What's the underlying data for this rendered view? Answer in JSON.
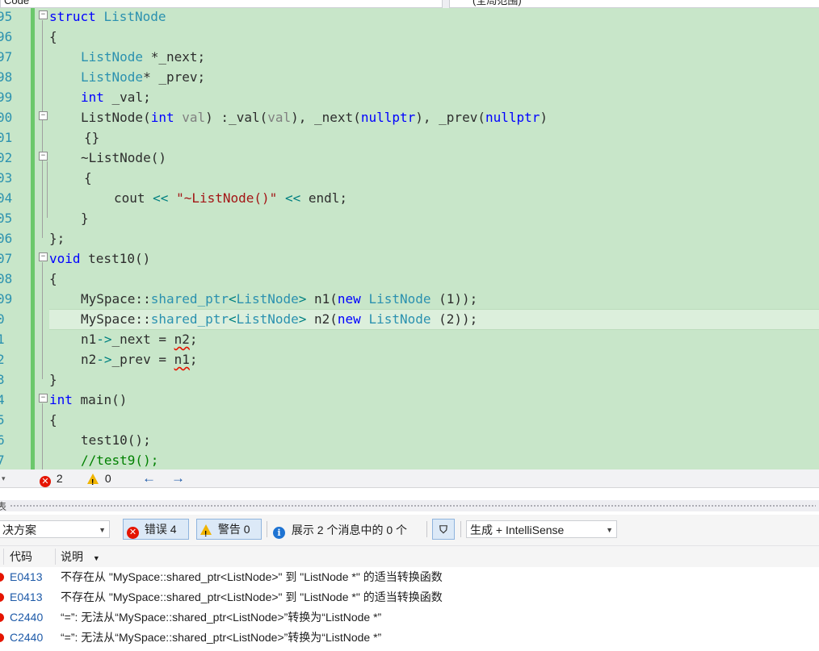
{
  "topbar": {
    "left_selector": "Code",
    "right_selector": "(全局范围)"
  },
  "editor": {
    "line_numbers": [
      "95",
      "96",
      "97",
      "98",
      "99",
      "00",
      "01",
      "02",
      "03",
      "04",
      "05",
      "06",
      "07",
      "08",
      "09",
      "0",
      "1",
      "2",
      "3",
      "4",
      "5",
      "6",
      "7"
    ],
    "lines": [
      {
        "n": "struct",
        "t": "ListNode"
      },
      {
        "t": "{"
      },
      {
        "t": "ListNode",
        "r": " *_next;"
      },
      {
        "t": "ListNode",
        "r": "* _prev;"
      },
      {
        "k": "int",
        "r": " _val;"
      },
      {
        "a": "ListNode(",
        "k": "int",
        "p": "val",
        "r": ") :_val(",
        "p2": "val",
        "r2": "), _next(",
        "k2": "nullptr",
        "r3": "), _prev(",
        "k3": "nullptr",
        "r4": ")"
      },
      {
        "t": "{}"
      },
      {
        "t": "~ListNode()"
      },
      {
        "t": "{"
      },
      {
        "a": "cout ",
        "o": "<<",
        "s": "\"~ListNode()\"",
        "o2": "<<",
        "r": " endl;"
      },
      {
        "t": "}"
      },
      {
        "t": "};"
      },
      {
        "k": "void",
        "r": " test10()"
      },
      {
        "t": "{"
      },
      {
        "a": "MySpace::",
        "y": "shared_ptr",
        "o": "<",
        "y2": "ListNode",
        "o2": ">",
        "r": " n1(",
        "k": "new",
        "y3": "ListNode",
        "r2": " (1));"
      },
      {
        "a": "MySpace::",
        "y": "shared_ptr",
        "o": "<",
        "y2": "ListNode",
        "o2": ">",
        "r": " n2(",
        "k": "new",
        "y3": "ListNode",
        "r2": " (2));"
      },
      {
        "a": "n1",
        "o": "->",
        "r": "_next = ",
        "e": "n2",
        "r2": ";"
      },
      {
        "a": "n2",
        "o": "->",
        "r": "_prev = ",
        "e": "n1",
        "r2": ";"
      },
      {
        "t": "}"
      },
      {
        "k": "int",
        "r": " main()"
      },
      {
        "t": "{"
      },
      {
        "t": "test10();"
      },
      {
        "c": "//test9();"
      }
    ]
  },
  "status_strip": {
    "error_count": "2",
    "warning_count": "0",
    "back_icon": "arrow-left-icon",
    "forward_icon": "arrow-right-icon"
  },
  "panel": {
    "title_fragment": "表",
    "scope_combo": "决方案",
    "errors_button": "错误 4",
    "warnings_button": "警告 0",
    "messages_text": "展示 2 个消息中的 0 个",
    "build_combo": "生成 + IntelliSense",
    "columns": {
      "code": "代码",
      "description": "说明"
    },
    "rows": [
      {
        "code": "E0413",
        "description": "不存在从 \"MySpace::shared_ptr<ListNode>\" 到 \"ListNode *\" 的适当转换函数"
      },
      {
        "code": "E0413",
        "description": "不存在从 \"MySpace::shared_ptr<ListNode>\" 到 \"ListNode *\" 的适当转换函数"
      },
      {
        "code": "C2440",
        "description": "“=”: 无法从“MySpace::shared_ptr<ListNode>”转换为“ListNode *”"
      },
      {
        "code": "C2440",
        "description": "“=”: 无法从“MySpace::shared_ptr<ListNode>”转换为“ListNode *”"
      }
    ]
  },
  "colors": {
    "editor_bg": "#c8e6c9",
    "keyword": "#0000ff",
    "type": "#2b91af",
    "string": "#a31515",
    "comment": "#008000",
    "error": "#e51400"
  }
}
